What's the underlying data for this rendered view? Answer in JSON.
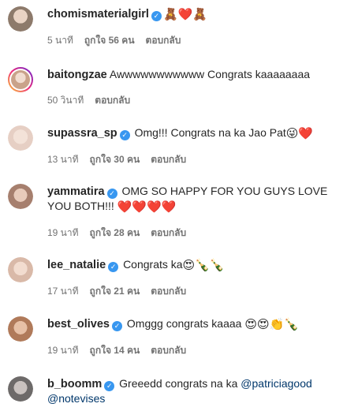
{
  "comments": [
    {
      "username": "chomismaterialgirl",
      "verified": true,
      "text": "",
      "emoji": "🧸❤️🧸",
      "time": "5 นาที",
      "likes": "ถูกใจ 56 คน",
      "reply": "ตอบกลับ",
      "avatar_color": "#8d7a6b"
    },
    {
      "username": "baitongzae",
      "verified": false,
      "text": "Awwwwwwwwwww Congrats kaaaaaaaa",
      "emoji": "",
      "time": "50 วินาที",
      "likes": "",
      "reply": "ตอบกลับ",
      "avatar_color": "#c9a38a"
    },
    {
      "username": "supassra_sp",
      "verified": true,
      "text": "Omg!!! Congrats na ka Jao Pat",
      "emoji": "😜❤️",
      "time": "13 นาที",
      "likes": "ถูกใจ 30 คน",
      "reply": "ตอบกลับ",
      "avatar_color": "#e6cfc4"
    },
    {
      "username": "yammatira",
      "verified": true,
      "text": "OMG SO HAPPY FOR YOU GUYS LOVE YOU BOTH!!!",
      "emoji": "❤️❤️❤️❤️",
      "time": "19 นาที",
      "likes": "ถูกใจ 28 คน",
      "reply": "ตอบกลับ",
      "avatar_color": "#a67f6e"
    },
    {
      "username": "lee_natalie",
      "verified": true,
      "text": "Congrats ka",
      "emoji": "😍🍾🍾",
      "time": "17 นาที",
      "likes": "ถูกใจ 21 คน",
      "reply": "ตอบกลับ",
      "avatar_color": "#d9b9a8"
    },
    {
      "username": "best_olives",
      "verified": true,
      "text": "Omggg congrats kaaaa",
      "emoji": "😍😍👏🍾",
      "time": "19 นาที",
      "likes": "ถูกใจ 14 คน",
      "reply": "ตอบกลับ",
      "avatar_color": "#b07a5a"
    },
    {
      "username": "b_boomm",
      "verified": true,
      "text": "Greeedd congrats na ka",
      "emoji": "",
      "mentions": "@patriciagood @notevises",
      "time": "",
      "likes": "",
      "reply": "",
      "avatar_color": "#6d6a69"
    }
  ]
}
